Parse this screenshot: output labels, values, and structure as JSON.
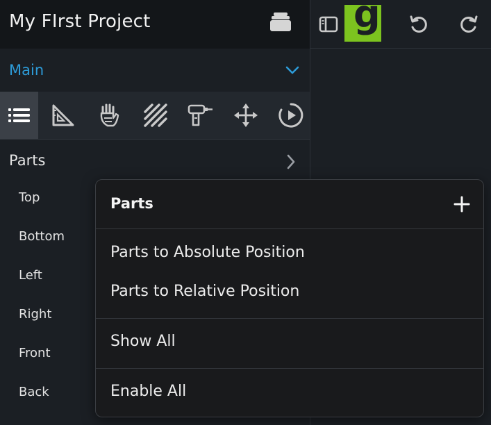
{
  "project": {
    "title": "My FIrst Project"
  },
  "section": {
    "label": "Main"
  },
  "toolbar": {
    "tools": [
      "list-icon",
      "set-square-icon",
      "hand-icon",
      "hatch-icon",
      "drill-icon",
      "move-icon",
      "play-icon"
    ]
  },
  "parts": {
    "heading": "Parts",
    "views": [
      "Top",
      "Bottom",
      "Left",
      "Right",
      "Front",
      "Back"
    ]
  },
  "topbar": {
    "logo_letter": "g",
    "buttons": [
      "sidebar-toggle-icon",
      "undo-icon",
      "redo-icon"
    ]
  },
  "context_menu": {
    "title": "Parts",
    "groups": [
      [
        "Parts to Absolute Position",
        "Parts to Relative Position"
      ],
      [
        "Show All"
      ],
      [
        "Enable All"
      ]
    ]
  },
  "colors": {
    "accent": "#2d9bd8",
    "logo_bg": "#7cc31f",
    "panel_bg": "#1b1f24",
    "menu_bg": "#191a1c"
  }
}
